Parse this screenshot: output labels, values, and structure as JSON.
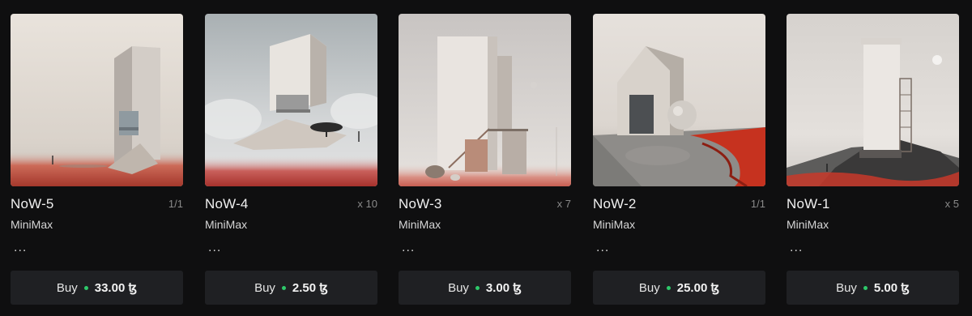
{
  "colors": {
    "background": "#0f0f10",
    "button_bg": "#1f2023",
    "status_dot": "#2ec96a"
  },
  "cards": [
    {
      "title": "NoW-5",
      "edition": "1/1",
      "artist": "MiniMax",
      "more": "...",
      "buy_label": "Buy",
      "price": "33.00 ꜩ",
      "status_icon": "green-dot-icon"
    },
    {
      "title": "NoW-4",
      "edition": "x 10",
      "artist": "MiniMax",
      "more": "...",
      "buy_label": "Buy",
      "price": "2.50 ꜩ",
      "status_icon": "green-dot-icon"
    },
    {
      "title": "NoW-3",
      "edition": "x 7",
      "artist": "MiniMax",
      "more": "...",
      "buy_label": "Buy",
      "price": "3.00 ꜩ",
      "status_icon": "green-dot-icon"
    },
    {
      "title": "NoW-2",
      "edition": "1/1",
      "artist": "MiniMax",
      "more": "...",
      "buy_label": "Buy",
      "price": "25.00 ꜩ",
      "status_icon": "green-dot-icon"
    },
    {
      "title": "NoW-1",
      "edition": "x 5",
      "artist": "MiniMax",
      "more": "...",
      "buy_label": "Buy",
      "price": "5.00 ꜩ",
      "status_icon": "green-dot-icon"
    }
  ]
}
